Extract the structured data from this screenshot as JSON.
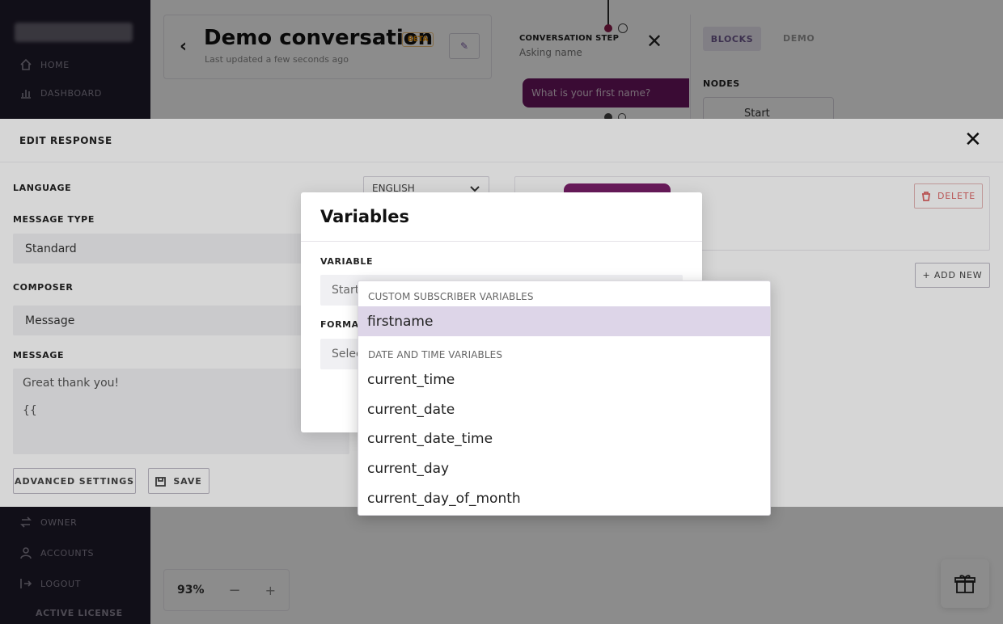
{
  "sidebar": {
    "items_top": [
      {
        "label": "HOME",
        "icon": "home-icon"
      },
      {
        "label": "DASHBOARD",
        "icon": "chart-icon"
      }
    ],
    "items_bottom": [
      {
        "label": "OWNER",
        "icon": "swap-icon"
      },
      {
        "label": "ACCOUNTS",
        "icon": "user-icon"
      },
      {
        "label": "LOGOUT",
        "icon": "logout-icon"
      }
    ],
    "license": "ACTIVE LICENSE"
  },
  "header": {
    "title": "Demo conversation",
    "badge": "BETA",
    "updated": "Last updated a few seconds ago"
  },
  "canvas": {
    "step_label": "CONVERSATION STEP",
    "step_sub": "Asking name",
    "bubble_text": "What is your first name?"
  },
  "right_panel": {
    "tabs": [
      "BLOCKS",
      "DEMO"
    ],
    "nodes_label": "NODES",
    "node_start": "Start"
  },
  "zoom": {
    "value": "93%",
    "minus": "−",
    "plus": "+"
  },
  "edit_response": {
    "title": "EDIT RESPONSE",
    "language_label": "LANGUAGE",
    "language_value": "ENGLISH",
    "message_type_label": "MESSAGE TYPE",
    "message_type_value": "Standard",
    "composer_label": "COMPOSER",
    "composer_value": "Message",
    "message_label": "MESSAGE",
    "message_line1": "Great thank you!",
    "message_line2": "{{",
    "advanced_label": "ADVANCED SETTINGS",
    "save_label": "SAVE",
    "delete_label": "DELETE",
    "add_new_label": "+ ADD NEW"
  },
  "variables_modal": {
    "title": "Variables",
    "variable_label": "VARIABLE",
    "variable_placeholder": "Start",
    "format_label": "FORMAT",
    "format_placeholder": "Selec"
  },
  "dropdown": {
    "groups": [
      {
        "label": "CUSTOM SUBSCRIBER VARIABLES",
        "items": [
          "firstname"
        ]
      },
      {
        "label": "DATE AND TIME VARIABLES",
        "items": [
          "current_time",
          "current_date",
          "current_date_time",
          "current_day",
          "current_day_of_month"
        ]
      }
    ],
    "highlighted": "firstname"
  },
  "colors": {
    "sidebar_bg": "#201c2c",
    "accent": "#7c1f6c",
    "highlight": "#ddd5e8",
    "danger": "#dd6666"
  }
}
